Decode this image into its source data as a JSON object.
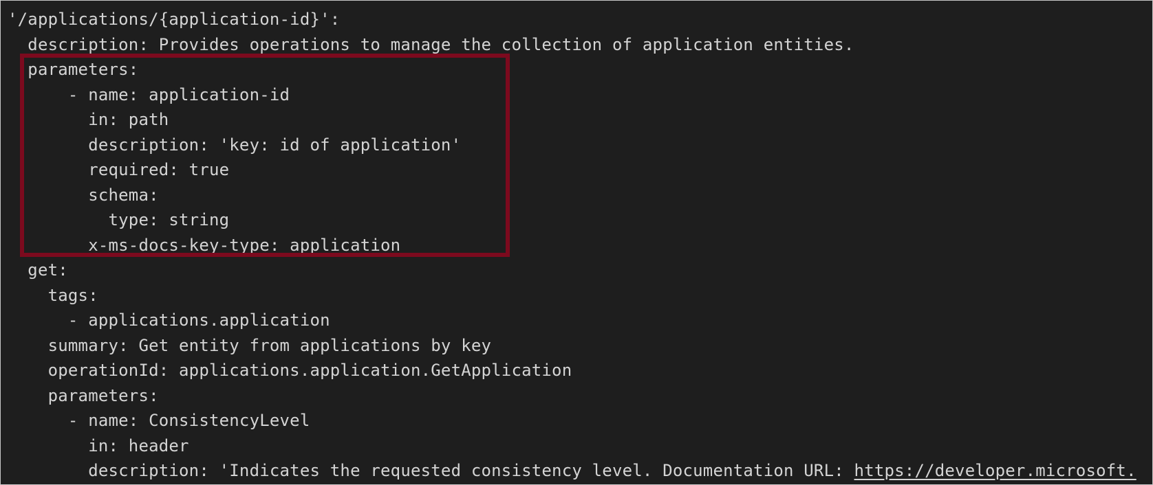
{
  "code": {
    "lines": [
      "'/applications/{application-id}':",
      "  description: Provides operations to manage the collection of application entities.",
      "  parameters:",
      "      - name: application-id",
      "        in: path",
      "        description: 'key: id of application'",
      "        required: true",
      "        schema:",
      "          type: string",
      "        x-ms-docs-key-type: application",
      "  get:",
      "    tags:",
      "      - applications.application",
      "    summary: Get entity from applications by key",
      "    operationId: applications.application.GetApplication",
      "    parameters:",
      "      - name: ConsistencyLevel",
      "        in: header"
    ],
    "last_line_prefix": "        description: 'Indicates the requested consistency level. Documentation URL: ",
    "last_line_link": "https://developer.microsoft."
  },
  "colors": {
    "editor_background": "#1e1e1e",
    "text": "#d4d4d4",
    "highlight_border": "#7c0a1e"
  }
}
